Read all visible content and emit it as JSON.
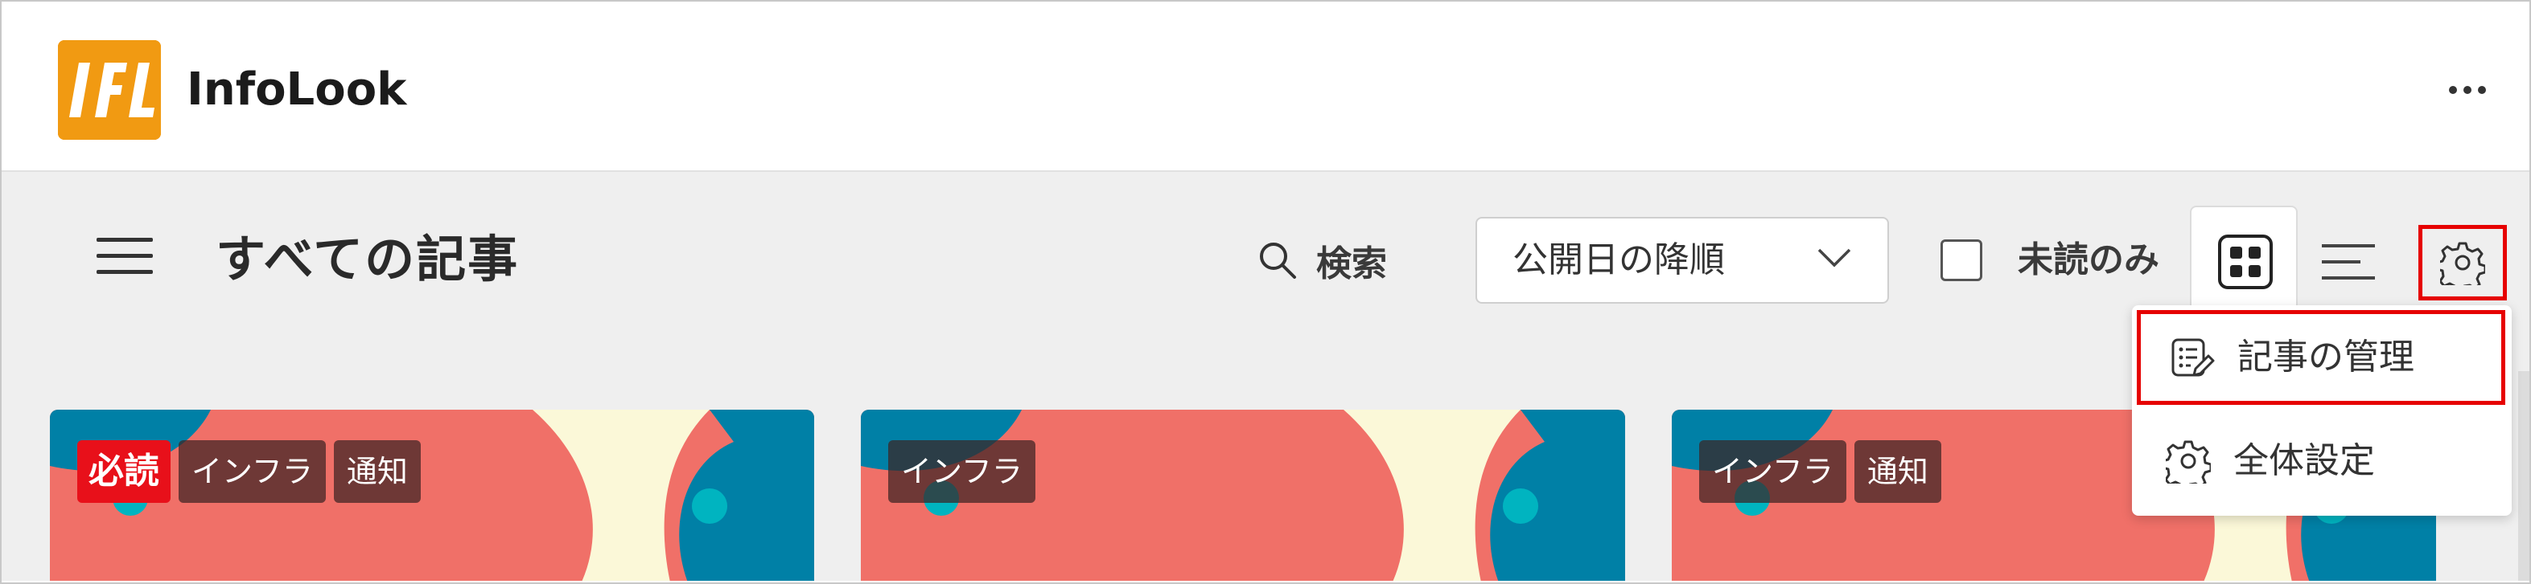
{
  "app": {
    "name": "InfoLook",
    "logo_text": "IfL"
  },
  "toolbar": {
    "title": "すべての記事",
    "search_label": "検索",
    "sort_value": "公開日の降順",
    "unread_label": "未読のみ",
    "unread_checked": false
  },
  "settings_menu": {
    "items": [
      {
        "label": "記事の管理",
        "icon": "edit-list-icon",
        "highlighted": true
      },
      {
        "label": "全体設定",
        "icon": "gear-icon",
        "highlighted": false
      }
    ]
  },
  "cards": [
    {
      "tags": [
        {
          "label": "必読",
          "type": "required"
        },
        {
          "label": "インフラ"
        },
        {
          "label": "通知"
        }
      ]
    },
    {
      "tags": [
        {
          "label": "インフラ"
        }
      ]
    },
    {
      "tags": [
        {
          "label": "インフラ"
        },
        {
          "label": "通知"
        }
      ]
    }
  ],
  "colors": {
    "logo_orange": "#f19a12",
    "highlight_red": "#e60000",
    "card_salmon": "#f07068",
    "card_teal": "#0080a6",
    "card_cream": "#fbf8d8",
    "required_badge": "#e8101a"
  }
}
